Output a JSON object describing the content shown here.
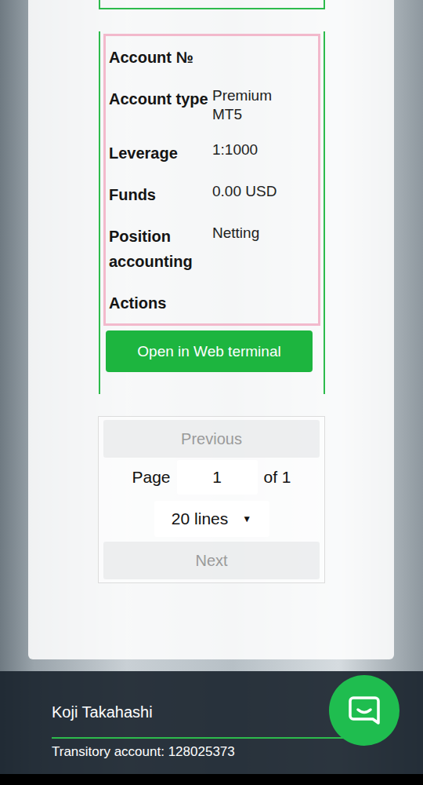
{
  "account_table": {
    "rows": [
      {
        "label": "Account №"
      },
      {
        "label": "Account type",
        "value": "Premium MT5"
      },
      {
        "label": "Leverage",
        "value": "1:1000"
      },
      {
        "label": "Funds",
        "value": "0.00 USD"
      },
      {
        "label": "Position accounting",
        "value": "Netting"
      },
      {
        "label": "Actions"
      }
    ]
  },
  "open_button": "Open in Web terminal",
  "pagination": {
    "previous": {
      "label": "Previous",
      "disabled": true
    },
    "page_label": "Page",
    "page_value": "1",
    "of_label": "of 1",
    "lines_select": "20 lines",
    "dropdown_icon": "▼",
    "next": {
      "label": "Next",
      "disabled": true
    }
  },
  "footer": {
    "user_name": "Koji Takahashi",
    "account_text": "Transitory account: 128025373"
  }
}
